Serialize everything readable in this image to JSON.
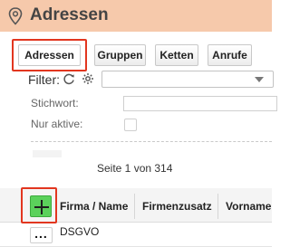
{
  "header": {
    "title": "Adressen",
    "icon": "location-pin-icon"
  },
  "tabs": [
    {
      "label": "Adressen",
      "active": true
    },
    {
      "label": "Gruppen",
      "active": false
    },
    {
      "label": "Ketten",
      "active": false
    },
    {
      "label": "Anrufe",
      "active": false
    }
  ],
  "filter": {
    "label": "Filter:",
    "icons": [
      "refresh-icon",
      "settings-icon"
    ],
    "selected": ""
  },
  "fields": {
    "stichwort_label": "Stichwort:",
    "stichwort_value": "",
    "nur_aktive_label": "Nur aktive:",
    "nur_aktive_checked": false
  },
  "pagination": {
    "text": "Seite 1 von 314"
  },
  "table": {
    "columns": [
      "Firma / Name",
      "Firmenzusatz",
      "Vorname"
    ],
    "rows": [
      {
        "more": "...",
        "firma": "DSGVO"
      }
    ]
  },
  "colors": {
    "header_bg": "#f6c9ab",
    "highlight": "#e2361f",
    "add_button": "#5bd15b"
  }
}
